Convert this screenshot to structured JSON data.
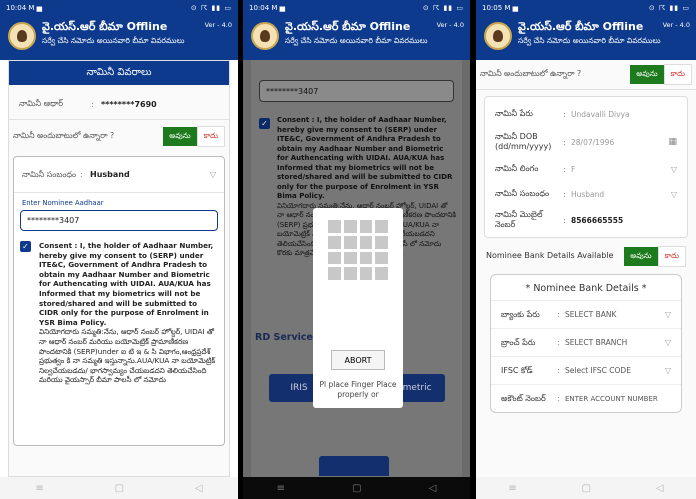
{
  "status": {
    "left": [
      "10:04 M ▅",
      "10:04 M ▅",
      "10:05 M ▅"
    ],
    "right": "⊙ ☈ ▮▮ ▭"
  },
  "app": {
    "title": "వై.యస్.ఆర్ బీమా Offline",
    "subtitle": "సర్వే చేసి నమోదు అయినవారి బీమా వివరములు",
    "version": "Ver - 4.0"
  },
  "screen1": {
    "section_title": "నామినీ వివరాలు",
    "aadhaar_label": "నామినీ ఆధార్",
    "aadhaar_value": "********7690",
    "alive_question": "నామినీ అందుబాటులో ఉన్నారా ?",
    "yes": "అవును",
    "no": "కాదు",
    "relation_label": "నామినీ సంబంధం",
    "relation_value": "Husband",
    "enter_aadhaar_label": "Enter Nominee Aadhaar",
    "aadhaar_input": "********3407",
    "consent_en": "Consent : I, the holder of Aadhaar Number, hereby give my consent to (SERP) under ITE&C, Government of Andhra Pradesh to obtain my Aadhaar Number and Biometric for Authencating with UIDAI. AUA/KUA has Informed that my biometrics will not be stored/shared and will be submitted to CIDR only for the purpose of Enrolment in YSR Bima Policy.",
    "consent_te": "వినియోగదారు సమ్మతి:నేను, ఆధార్ నంబర్ హోల్డర్, UIDAI తో నా ఆధార్ నంబర్ మరియు బయోమెట్రిక్ ప్రామాణీకరణ పొందటానికి (SERP)under ఐ టి ఇ & సి విభాగం,ఆంధ్రప్రదేశ్ ప్రభుత్వం కి నా సమ్మతి ఇస్తున్నాను.AUA/KUA నా బయోమెట్రిక్ నిల్వచేయబడదు/ భాగస్వామ్యం చేయబడదని తెలియచేసింది మరియు వైయస్సార్ బీమా పాలసీ లో నమోదు"
  },
  "screen2": {
    "aadhaar_input": "********3407",
    "consent_en": "Consent : I, the holder of Aadhaar Number, hereby give my consent to (SERP) under ITE&C, Government of Andhra Pradesh to obtain my Aadhaar Number and Biometric for Authencating with UIDAI. AUA/KUA has Informed that my biometrics will not be stored/shared and will be submitted to CIDR only for the purpose of Enrolment in YSR Bima Policy.",
    "consent_te": "వినియోగదారు సమ్మతి:నేను, ఆధార్ నంబర్ హోల్డర్, UIDAI తో నా ఆధార్ నంబర్ మరియు బయోమెట్రిక్ ప్రామాణీకరణ పొందటానికి (SERP) ప్రభుత్వం కి నా సమ్మతి ఇస్తున్నాను.AUA/KUA నా బయోమెట్రిక్ నిల్వచేయబడదు/ భాగస్వామ్యం చేయబడదని తెలియచేసింది మరియు వైయస్సార్ బీమా పాలసీ లో నమోదు కొరకు మాత్రమే CIDR కి సమర్పించబడుతుంది.",
    "rd_service": "RD Service:",
    "iris": "IRIS",
    "biometric": "Biometric",
    "dialog_abort": "ABORT",
    "dialog_msg": "Pl place Finger Place properly or"
  },
  "screen3": {
    "alive_question": "నామినీ అందుబాటులో ఉన్నారా ?",
    "yes": "అవును",
    "no": "కాదు",
    "fields": [
      {
        "label": "నామినీ పేరు",
        "value": "Undavalli Divya",
        "dark": false
      },
      {
        "label": "నామినీ DOB (dd/mm/yyyy)",
        "value": "28/07/1996",
        "dark": false
      },
      {
        "label": "నామినీ లింగం",
        "value": "F",
        "dark": false
      },
      {
        "label": "నామినీ సంబంధం",
        "value": "Husband",
        "dark": false
      },
      {
        "label": "నామినీ మొబైల్ నెంబర్",
        "value": "8566665555",
        "dark": true
      }
    ],
    "bank_question": "Nominee Bank Details Available",
    "bank_title": "* Nominee Bank Details *",
    "bank_fields": [
      {
        "label": "బ్యాంకు పేరు",
        "value": "SELECT BANK"
      },
      {
        "label": "బ్రాంచ్ పేరు",
        "value": "SELECT BRANCH"
      },
      {
        "label": "IFSC కోడ్",
        "value": "Select IFSC CODE"
      },
      {
        "label": "అకౌంట్ నెంబర్",
        "value": "ENTER ACCOUNT NUMBER"
      }
    ]
  },
  "nav": {
    "recent": "≡",
    "home": "▢",
    "back": "◁"
  }
}
